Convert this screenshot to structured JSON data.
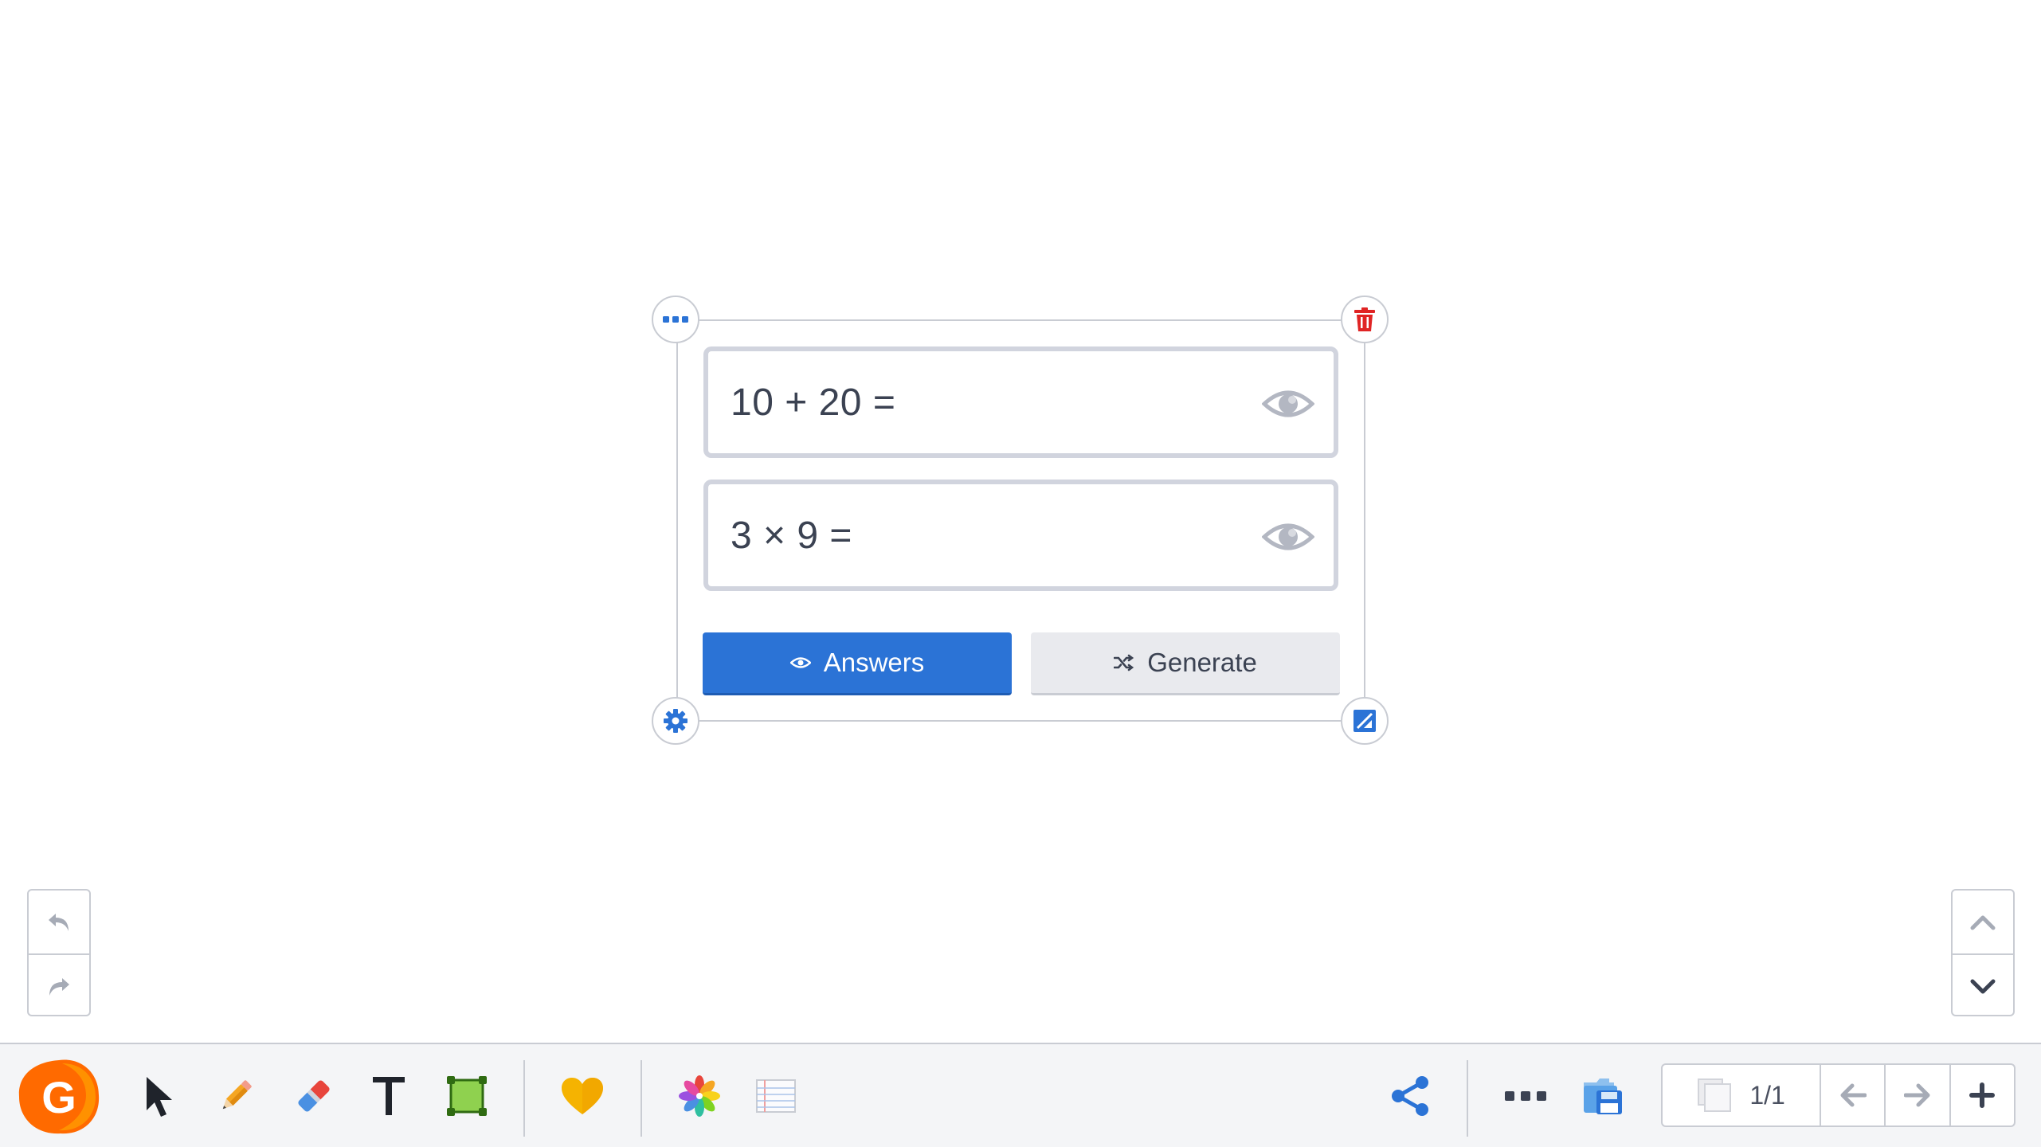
{
  "widget": {
    "questions": [
      {
        "text": "10 + 20 ="
      },
      {
        "text": "3 × 9 ="
      }
    ],
    "buttons": {
      "answers_label": "Answers",
      "generate_label": "Generate"
    },
    "colors": {
      "primary": "#2b73d6",
      "delete": "#e02424",
      "border": "#c9ccd3"
    }
  },
  "toolbar": {
    "logo_letter": "G",
    "logo_color": "#ff6a00",
    "tools": [
      "select-arrow-icon",
      "pencil-icon",
      "eraser-icon",
      "text-tool-icon",
      "shape-tool-icon",
      "heart-stickers-icon",
      "color-wheel-icon",
      "notebook-paper-icon"
    ],
    "right_tools": [
      "share-icon",
      "more-icon",
      "save-icon"
    ],
    "pager": {
      "page_label": "1/1"
    }
  }
}
